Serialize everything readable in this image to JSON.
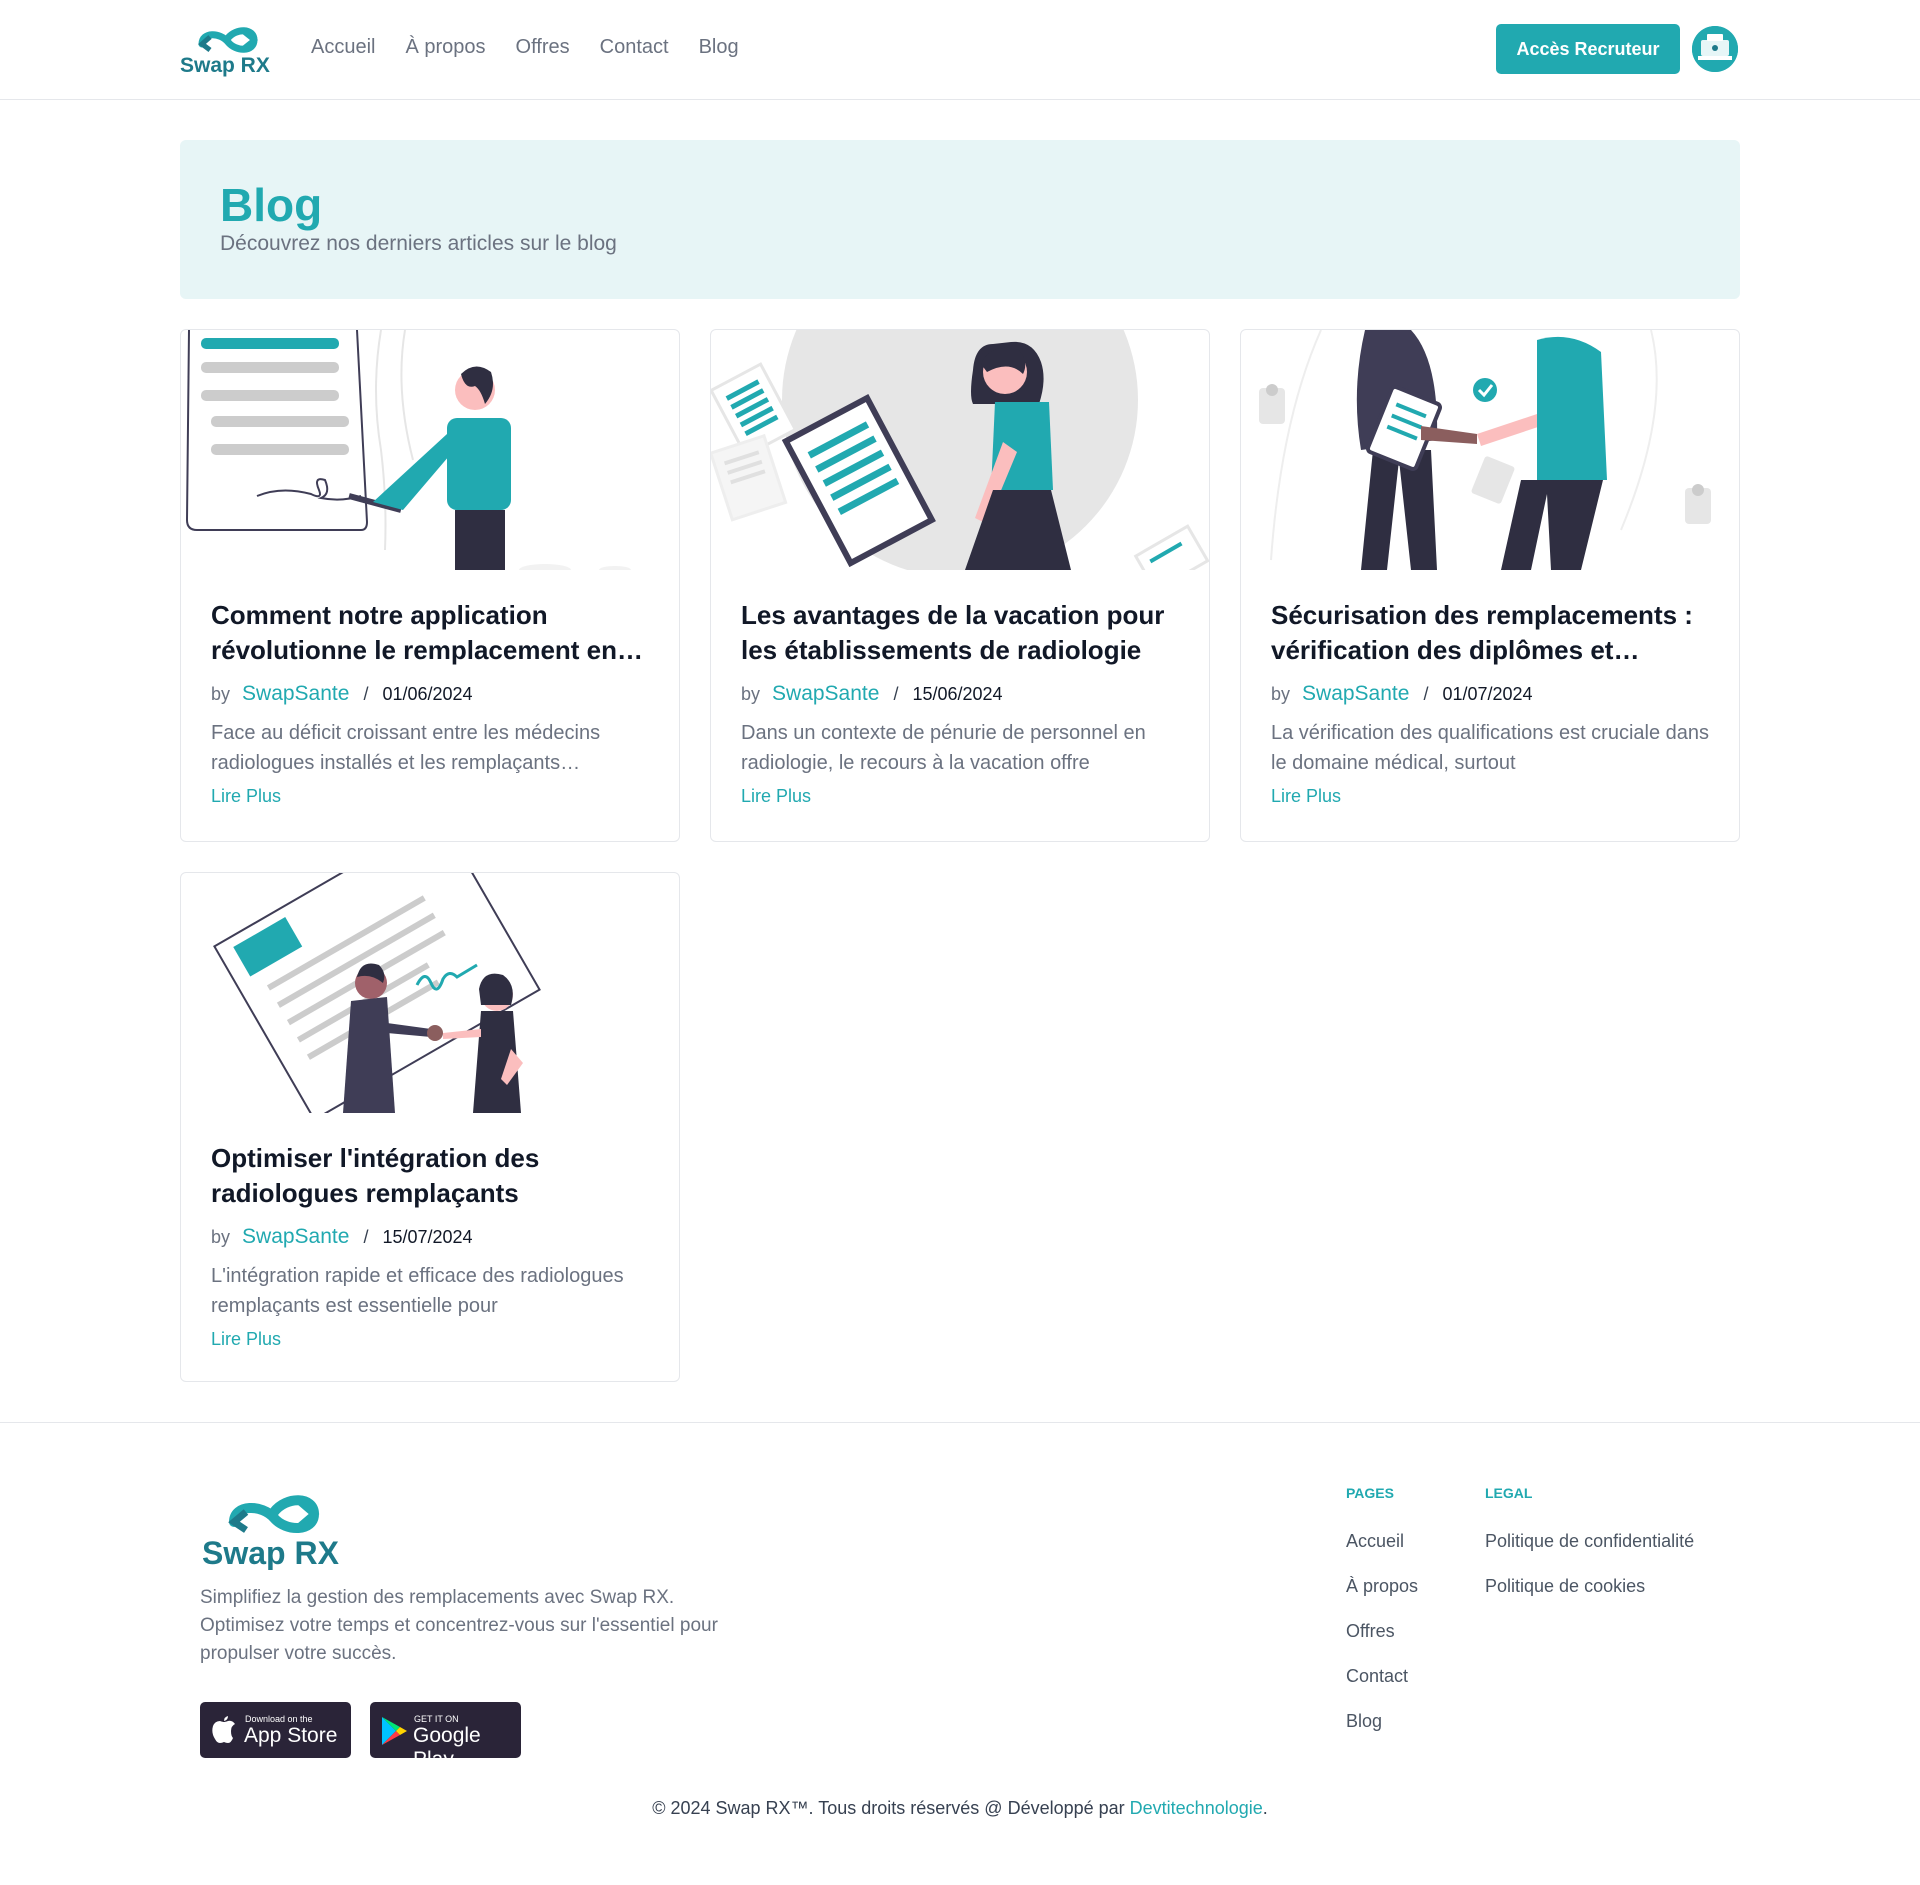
{
  "header": {
    "logo_text": "Swap RX",
    "nav": [
      "Accueil",
      "À propos",
      "Offres",
      "Contact",
      "Blog"
    ],
    "cta_label": "Accès Recruteur"
  },
  "hero": {
    "title": "Blog",
    "subtitle": "Découvrez nos derniers articles sur le blog"
  },
  "posts": [
    {
      "title": "Comment notre application révolutionne le remplacement en radiologie",
      "by": "by",
      "author": "SwapSante",
      "sep": "/",
      "date": "01/06/2024",
      "excerpt": "Face au déficit croissant entre les médecins radiologues installés et les remplaçants disponibles",
      "link": "Lire Plus",
      "image_icon": "signing-document-illustration"
    },
    {
      "title": "Les avantages de la vacation pour les établissements de radiologie",
      "by": "by",
      "author": "SwapSante",
      "sep": "/",
      "date": "15/06/2024",
      "excerpt": "Dans un contexte de pénurie de personnel en radiologie, le recours à la vacation offre",
      "link": "Lire Plus",
      "image_icon": "woman-clipboard-illustration"
    },
    {
      "title": "Sécurisation des remplacements : vérification des diplômes et qualifications",
      "by": "by",
      "author": "SwapSante",
      "sep": "/",
      "date": "01/07/2024",
      "excerpt": "La vérification des qualifications est cruciale dans le domaine médical, surtout",
      "link": "Lire Plus",
      "image_icon": "handshake-verified-illustration"
    },
    {
      "title": "Optimiser l'intégration des radiologues remplaçants",
      "by": "by",
      "author": "SwapSante",
      "sep": "/",
      "date": "15/07/2024",
      "excerpt": "L'intégration rapide et efficace des radiologues remplaçants est essentielle pour",
      "link": "Lire Plus",
      "image_icon": "contract-handshake-illustration"
    }
  ],
  "footer": {
    "logo_text": "Swap RX",
    "description": "Simplifiez la gestion des remplacements avec Swap RX. Optimisez votre temps et concentrez-vous sur l'essentiel pour propulser votre succès.",
    "app_store": {
      "small": "Download on the",
      "big": "App Store"
    },
    "google_play": {
      "small": "GET IT ON",
      "big": "Google Play"
    },
    "pages_heading": "PAGES",
    "pages": [
      "Accueil",
      "À propos",
      "Offres",
      "Contact",
      "Blog"
    ],
    "legal_heading": "LEGAL",
    "legal": [
      "Politique de confidentialité",
      "Politique de cookies"
    ],
    "copyright": "© 2024 Swap RX™. Tous droits réservés @ Développé par ",
    "dev_link": "Devtitechnologie",
    "copyright_end": "."
  },
  "colors": {
    "accent": "#21a9b0",
    "hero_bg": "#e7f5f6",
    "dark": "#2a2438"
  }
}
